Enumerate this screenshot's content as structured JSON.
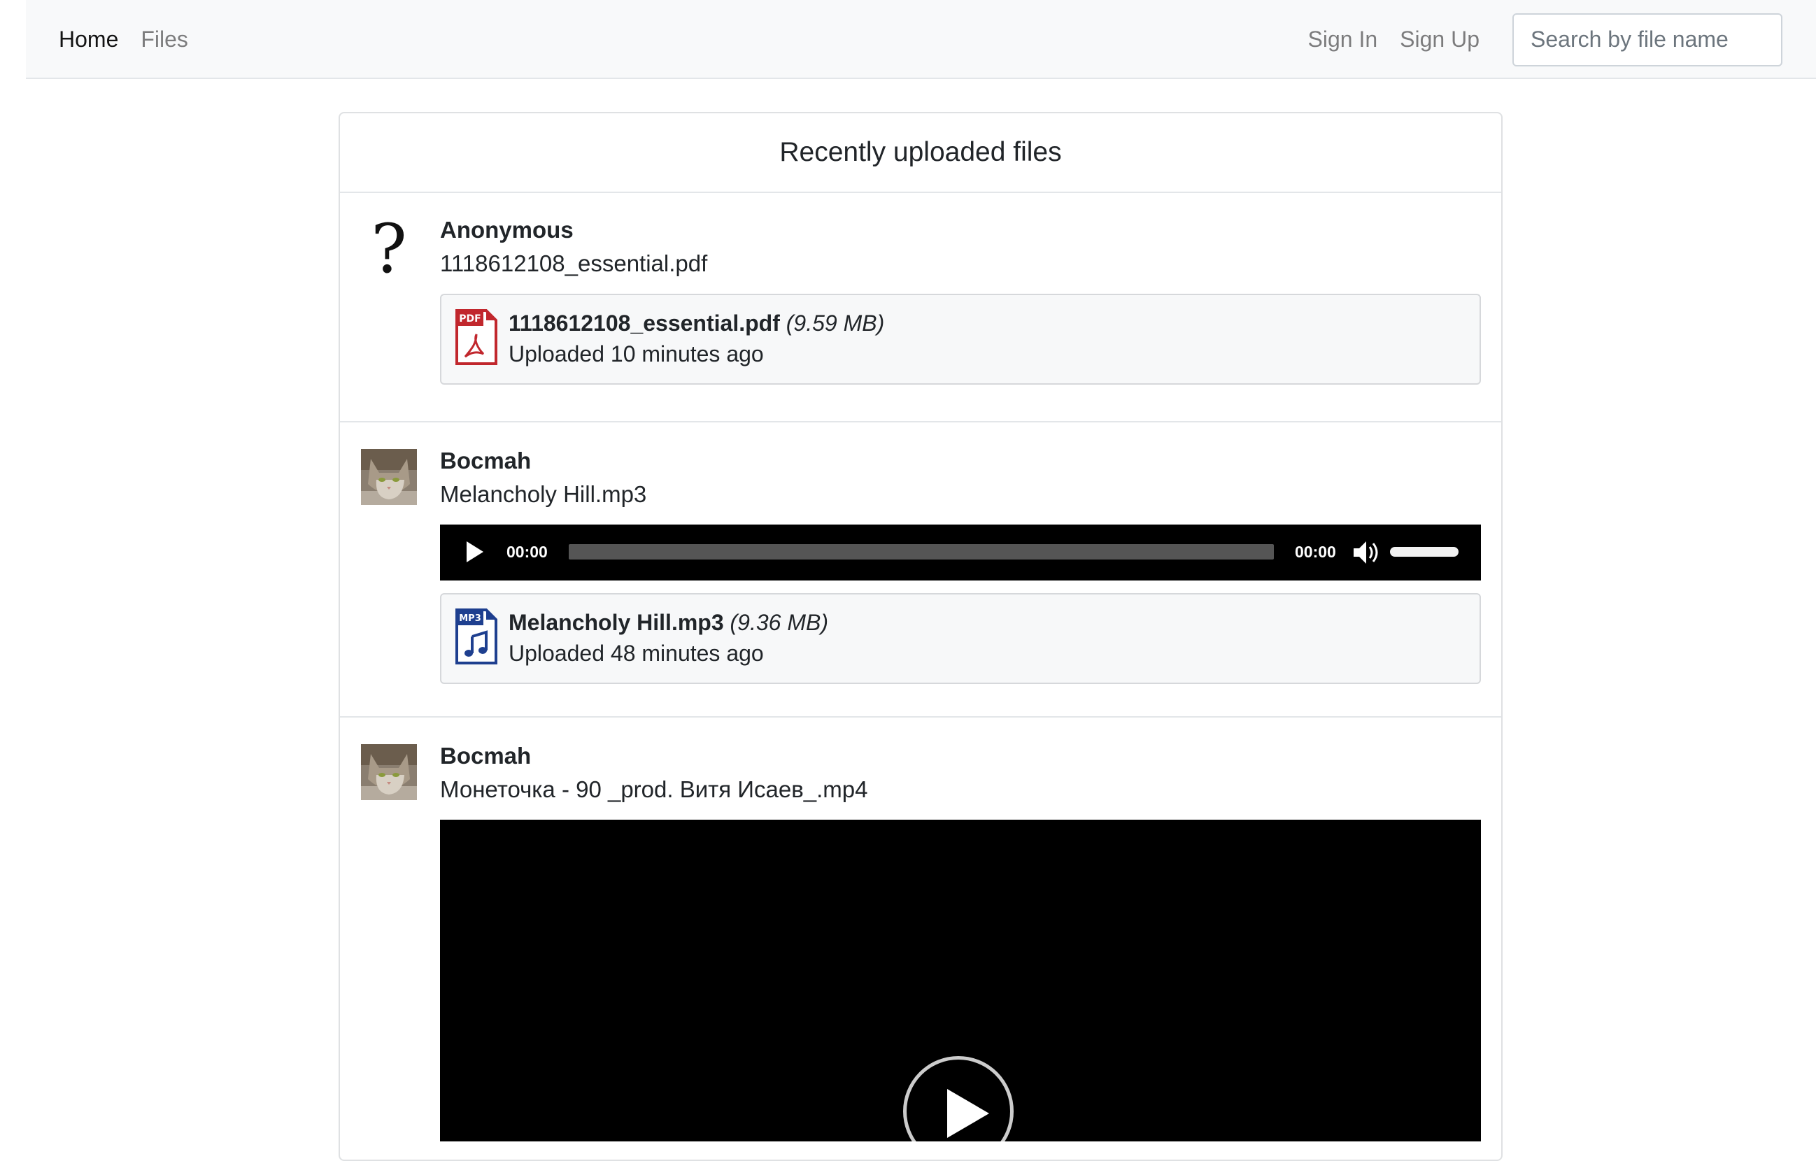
{
  "nav": {
    "home": "Home",
    "files": "Files",
    "sign_in": "Sign In",
    "sign_up": "Sign Up",
    "search_placeholder": "Search by file name"
  },
  "card": {
    "title": "Recently uploaded files"
  },
  "items": [
    {
      "user": "Anonymous",
      "avatar": "question-mark",
      "file_name": "1118612108_essential.pdf",
      "attachment": {
        "icon": "pdf-file-icon",
        "icon_label": "PDF",
        "name": "1118612108_essential.pdf",
        "size": "(9.59 MB)",
        "uploaded": "Uploaded 10 minutes ago"
      }
    },
    {
      "user": "Bocmah",
      "avatar": "cat-photo",
      "file_name": "Melancholy Hill.mp3",
      "player": {
        "current_time": "00:00",
        "duration": "00:00"
      },
      "attachment": {
        "icon": "mp3-file-icon",
        "icon_label": "MP3",
        "name": "Melancholy Hill.mp3",
        "size": "(9.36 MB)",
        "uploaded": "Uploaded 48 minutes ago"
      }
    },
    {
      "user": "Bocmah",
      "avatar": "cat-photo",
      "file_name": "Монеточка - 90 _prod. Витя Исаев_.mp4"
    }
  ],
  "colors": {
    "pdf_red": "#c1272d",
    "mp3_blue": "#1e3f8f",
    "navbar_bg": "#f8f9fa"
  }
}
